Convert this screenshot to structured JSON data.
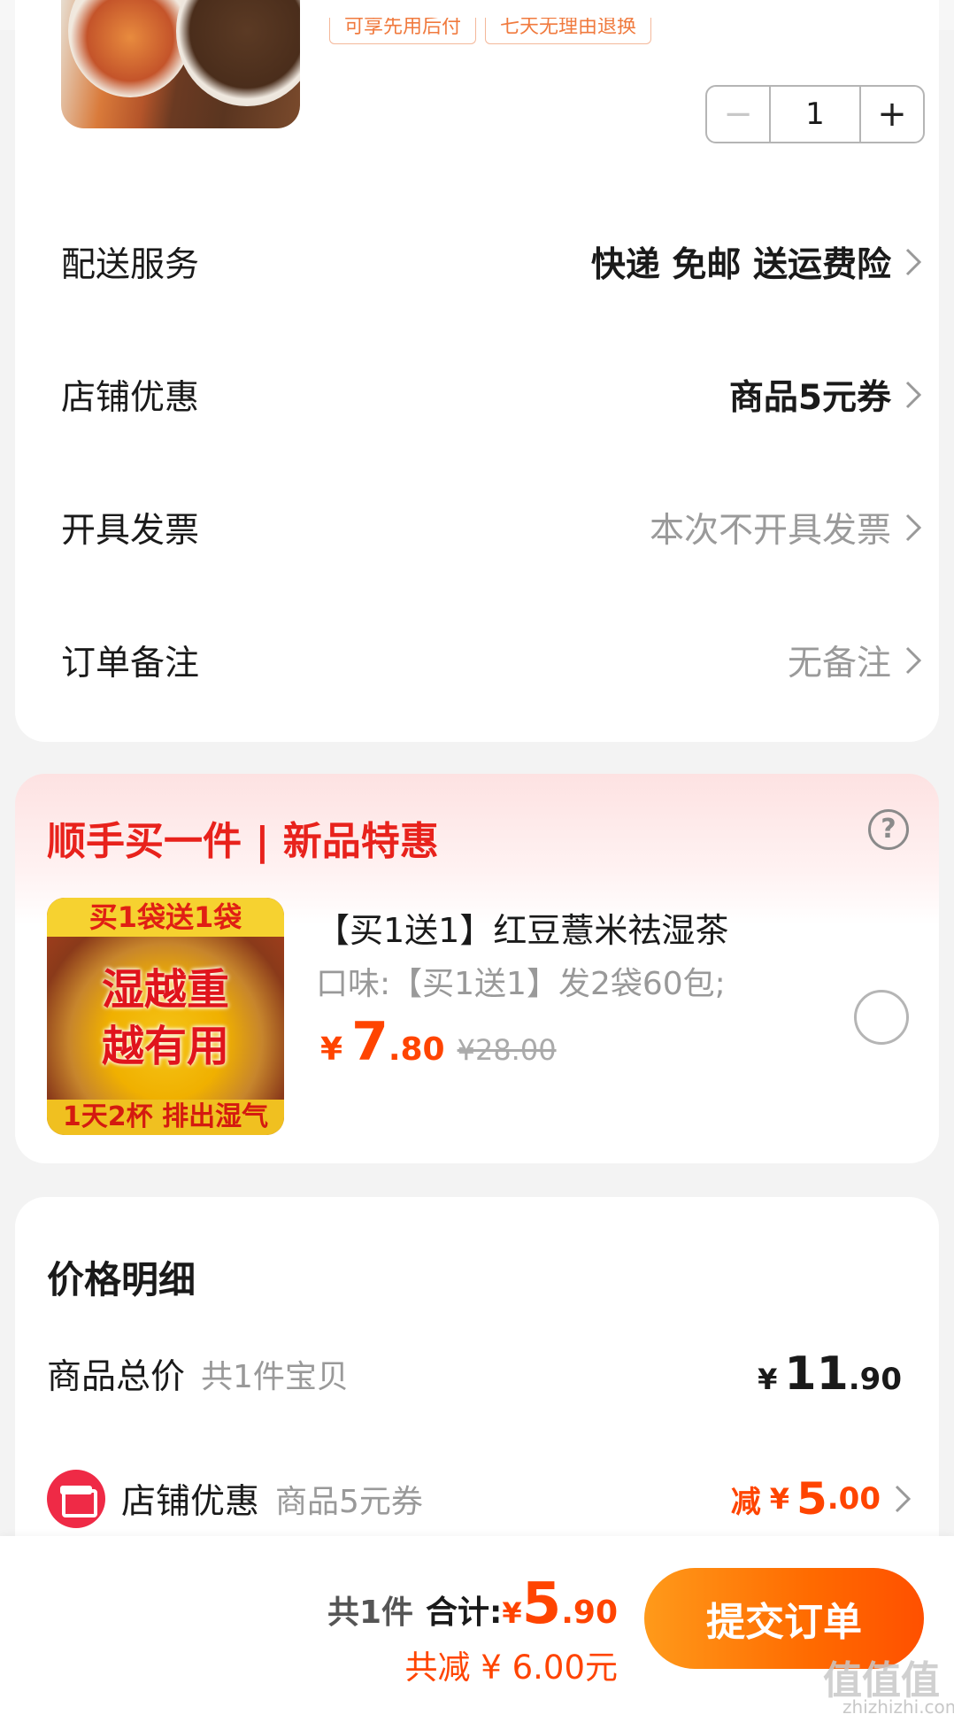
{
  "product": {
    "tags": [
      "可享先用后付",
      "七天无理由退换"
    ],
    "quantity": "1",
    "minus_symbol": "−",
    "plus_symbol": "+"
  },
  "rows": [
    {
      "label": "配送服务",
      "value": "快递 免邮 送运费险",
      "style": "dark"
    },
    {
      "label": "店铺优惠",
      "value": "商品5元券",
      "style": "dark"
    },
    {
      "label": "开具发票",
      "value": "本次不开具发票",
      "style": "grey"
    },
    {
      "label": "订单备注",
      "value": "无备注",
      "style": "grey"
    }
  ],
  "upsell": {
    "title": "顺手买一件 | 新品特惠",
    "help_symbol": "?",
    "thumb_banner": "买1袋送1袋",
    "thumb_line1": "湿越重",
    "thumb_line2": "越有用",
    "thumb_footer": "1天2杯 排出湿气",
    "name": "【买1送1】红豆薏米祛湿茶",
    "spec": "口味:【买1送1】发2袋60包;",
    "price_yen": "¥",
    "price_int": "7",
    "price_dec": ".80",
    "original_price": "¥28.00"
  },
  "price_detail": {
    "title": "价格明细",
    "total_label": "商品总价",
    "total_sub": "共1件宝贝",
    "total_yen": "¥",
    "total_int": "11",
    "total_dec": ".90",
    "discount_label": "店铺优惠",
    "discount_sub": "商品5元券",
    "discount_prefix": "减",
    "discount_yen": "¥",
    "discount_int": "5",
    "discount_dec": ".00"
  },
  "bottom_bar": {
    "count": "共1件",
    "sum_label": "合计:",
    "sum_yen": "¥",
    "sum_int": "5",
    "sum_dec": ".90",
    "saved": "共减 ¥ 6.00元",
    "submit_label": "提交订单"
  },
  "watermark": {
    "text": "值值值",
    "url": "zhizhizhi.com"
  },
  "colors": {
    "accent": "#ff4400",
    "upsell_title": "#e8221c",
    "submit_start": "#ff9a1a",
    "submit_end": "#ff5000"
  }
}
